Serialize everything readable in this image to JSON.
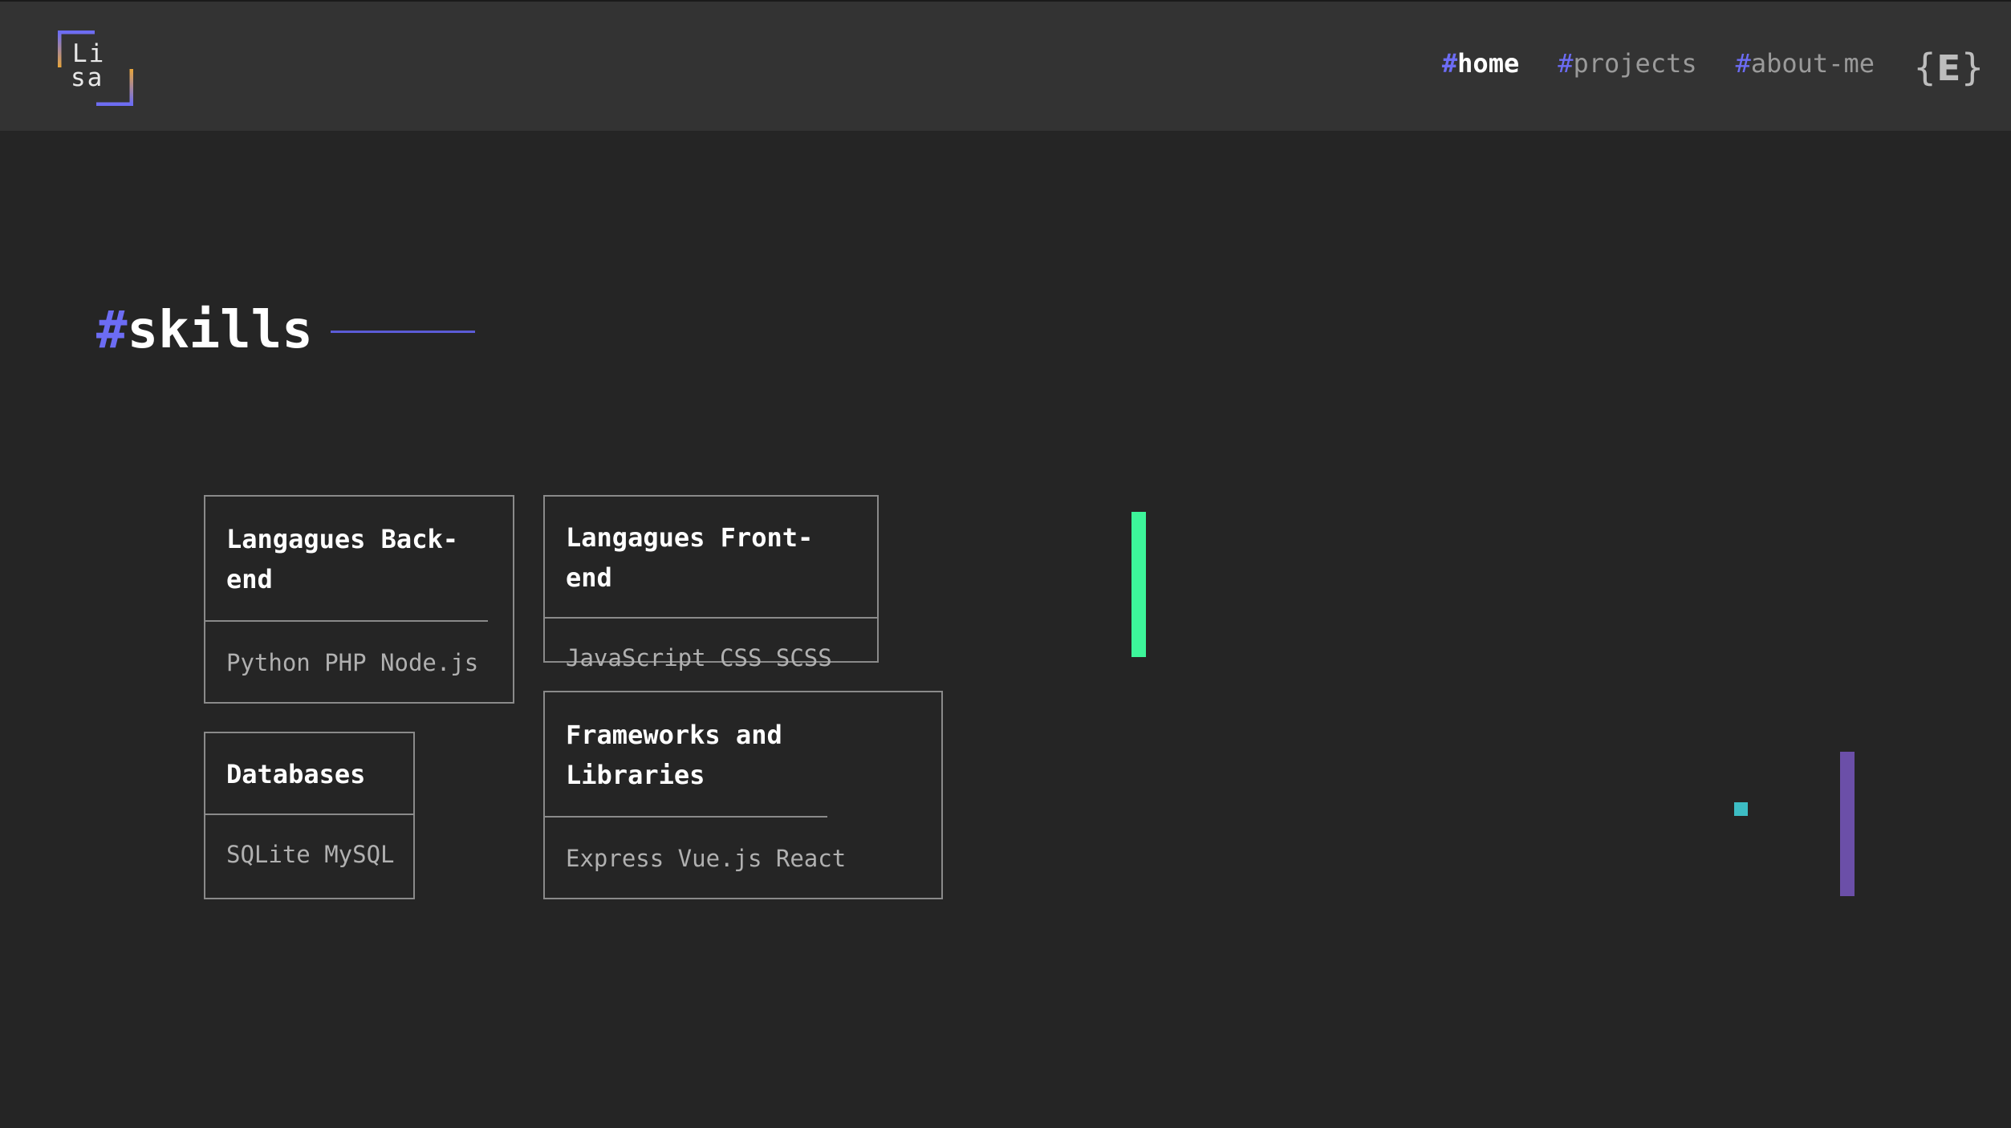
{
  "header": {
    "logo": {
      "line1": "Li",
      "line2": "sa",
      "colors": [
        "#6c6cf4",
        "#e8a53a"
      ]
    },
    "nav": [
      {
        "hash": "#",
        "label": "home",
        "active": true
      },
      {
        "hash": "#",
        "label": "projects",
        "active": false
      },
      {
        "hash": "#",
        "label": "about-me",
        "active": false
      }
    ],
    "language_icon": {
      "left": "{",
      "letter": "E",
      "right": "}"
    }
  },
  "section": {
    "hash": "#",
    "title": "skills"
  },
  "cards": [
    {
      "title": "Langagues Back-end",
      "items": "Python PHP Node.js"
    },
    {
      "title": "Langagues Front-end",
      "items": "JavaScript CSS SCSS"
    },
    {
      "title": "Databases",
      "items": "SQLite MySQL"
    },
    {
      "title": "Frameworks and Libraries",
      "items": "Express Vue.js React"
    }
  ],
  "decorations": {
    "colors": [
      "#3df59a",
      "#3dbdc4",
      "#6b4fa8"
    ]
  }
}
